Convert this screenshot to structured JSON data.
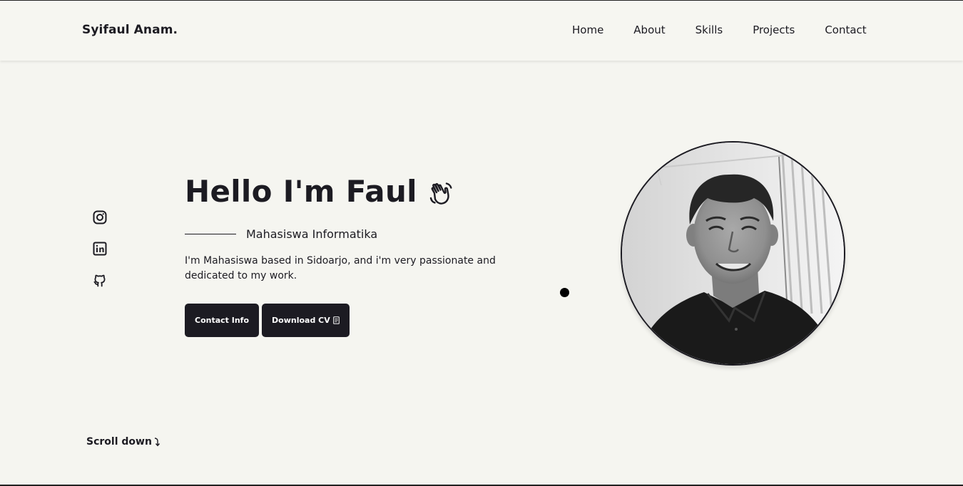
{
  "header": {
    "logo": "Syifaul Anam.",
    "nav": [
      "Home",
      "About",
      "Skills",
      "Projects",
      "Contact"
    ]
  },
  "social": {
    "icons": [
      "instagram-icon",
      "linkedin-icon",
      "github-icon"
    ]
  },
  "hero": {
    "title": "Hello I'm Faul",
    "title_icon": "waving-hand-icon",
    "subtitle": "Mahasiswa Informatika",
    "description": "I'm Mahasiswa based in Sidoarjo, and i'm very passionate and dedicated to my work.",
    "buttons": {
      "contact": "Contact Info",
      "download": "Download CV",
      "download_icon": "document-icon"
    }
  },
  "scroll": {
    "label": "Scroll down",
    "icon": "arrow-down-right-icon"
  },
  "colors": {
    "background": "#f5f5f0",
    "text": "#1c1b22",
    "button_bg": "#1c1b22",
    "button_text": "#ffffff"
  }
}
